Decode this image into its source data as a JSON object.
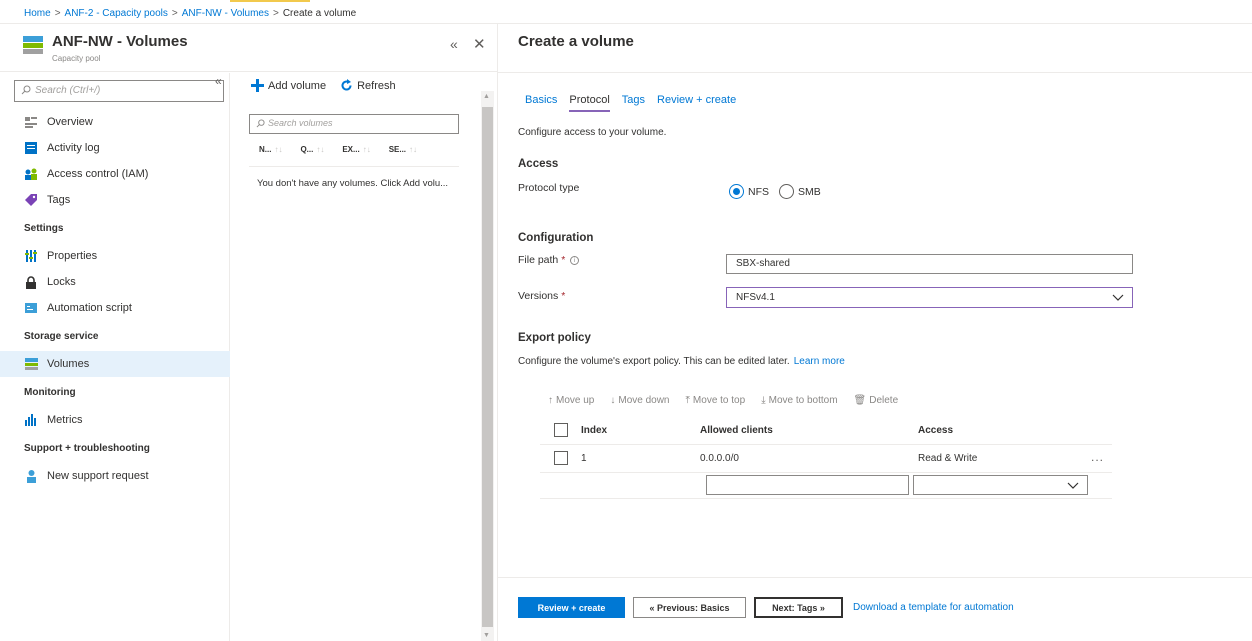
{
  "breadcrumb": {
    "items": [
      "Home",
      "ANF-2 - Capacity pools",
      "ANF-NW - Volumes"
    ],
    "current": "Create a volume",
    "separator": ">"
  },
  "resource": {
    "title": "ANF-NW - Volumes",
    "subtitle": "Capacity pool",
    "icon": "capacity-pool-icon"
  },
  "sidebar": {
    "search_placeholder": "Search (Ctrl+/)",
    "items": [
      {
        "label": "Overview",
        "icon": "overview-icon"
      },
      {
        "label": "Activity log",
        "icon": "activity-log-icon"
      },
      {
        "label": "Access control (IAM)",
        "icon": "iam-icon"
      },
      {
        "label": "Tags",
        "icon": "tag-icon"
      }
    ],
    "sections": [
      {
        "title": "Settings",
        "items": [
          {
            "label": "Properties",
            "icon": "properties-icon"
          },
          {
            "label": "Locks",
            "icon": "lock-icon"
          },
          {
            "label": "Automation script",
            "icon": "automation-icon"
          }
        ]
      },
      {
        "title": "Storage service",
        "items": [
          {
            "label": "Volumes",
            "icon": "volumes-icon"
          }
        ]
      },
      {
        "title": "Monitoring",
        "items": [
          {
            "label": "Metrics",
            "icon": "metrics-icon"
          }
        ]
      },
      {
        "title": "Support + troubleshooting",
        "items": [
          {
            "label": "New support request",
            "icon": "support-icon"
          }
        ]
      }
    ]
  },
  "volumes": {
    "add_label": "Add volume",
    "refresh_label": "Refresh",
    "search_placeholder": "Search volumes",
    "columns": [
      "N...",
      "Q...",
      "EX...",
      "SE..."
    ],
    "empty_message": "You don't have any volumes. Click Add volu..."
  },
  "blade": {
    "title": "Create a volume",
    "tabs": [
      "Basics",
      "Protocol",
      "Tags",
      "Review + create"
    ],
    "active_tab": "Protocol",
    "intro": "Configure access to your volume.",
    "access": {
      "heading": "Access",
      "protocol_label": "Protocol type",
      "options": [
        "NFS",
        "SMB"
      ],
      "selected": "NFS"
    },
    "configuration": {
      "heading": "Configuration",
      "file_path_label": "File path",
      "file_path_value": "SBX-shared",
      "versions_label": "Versions",
      "versions_value": "NFSv4.1",
      "required_marker": "*"
    },
    "export_policy": {
      "heading": "Export policy",
      "description": "Configure the volume's export policy. This can be edited later.",
      "learn_more": "Learn more",
      "toolbar": [
        "Move up",
        "Move down",
        "Move to top",
        "Move to bottom",
        "Delete"
      ],
      "columns": [
        "Index",
        "Allowed clients",
        "Access"
      ],
      "rows": [
        {
          "index": "1",
          "clients": "0.0.0.0/0",
          "access": "Read & Write",
          "more": "..."
        }
      ]
    },
    "footer": {
      "review_create": "Review + create",
      "previous": "« Previous: Basics",
      "next": "Next: Tags »",
      "download_link": "Download a template for automation"
    }
  },
  "colors": {
    "accent": "#0078d4",
    "tab_underline": "#8764b8",
    "active_nav_bg": "#e5f1fb",
    "required": "#a4262c"
  }
}
